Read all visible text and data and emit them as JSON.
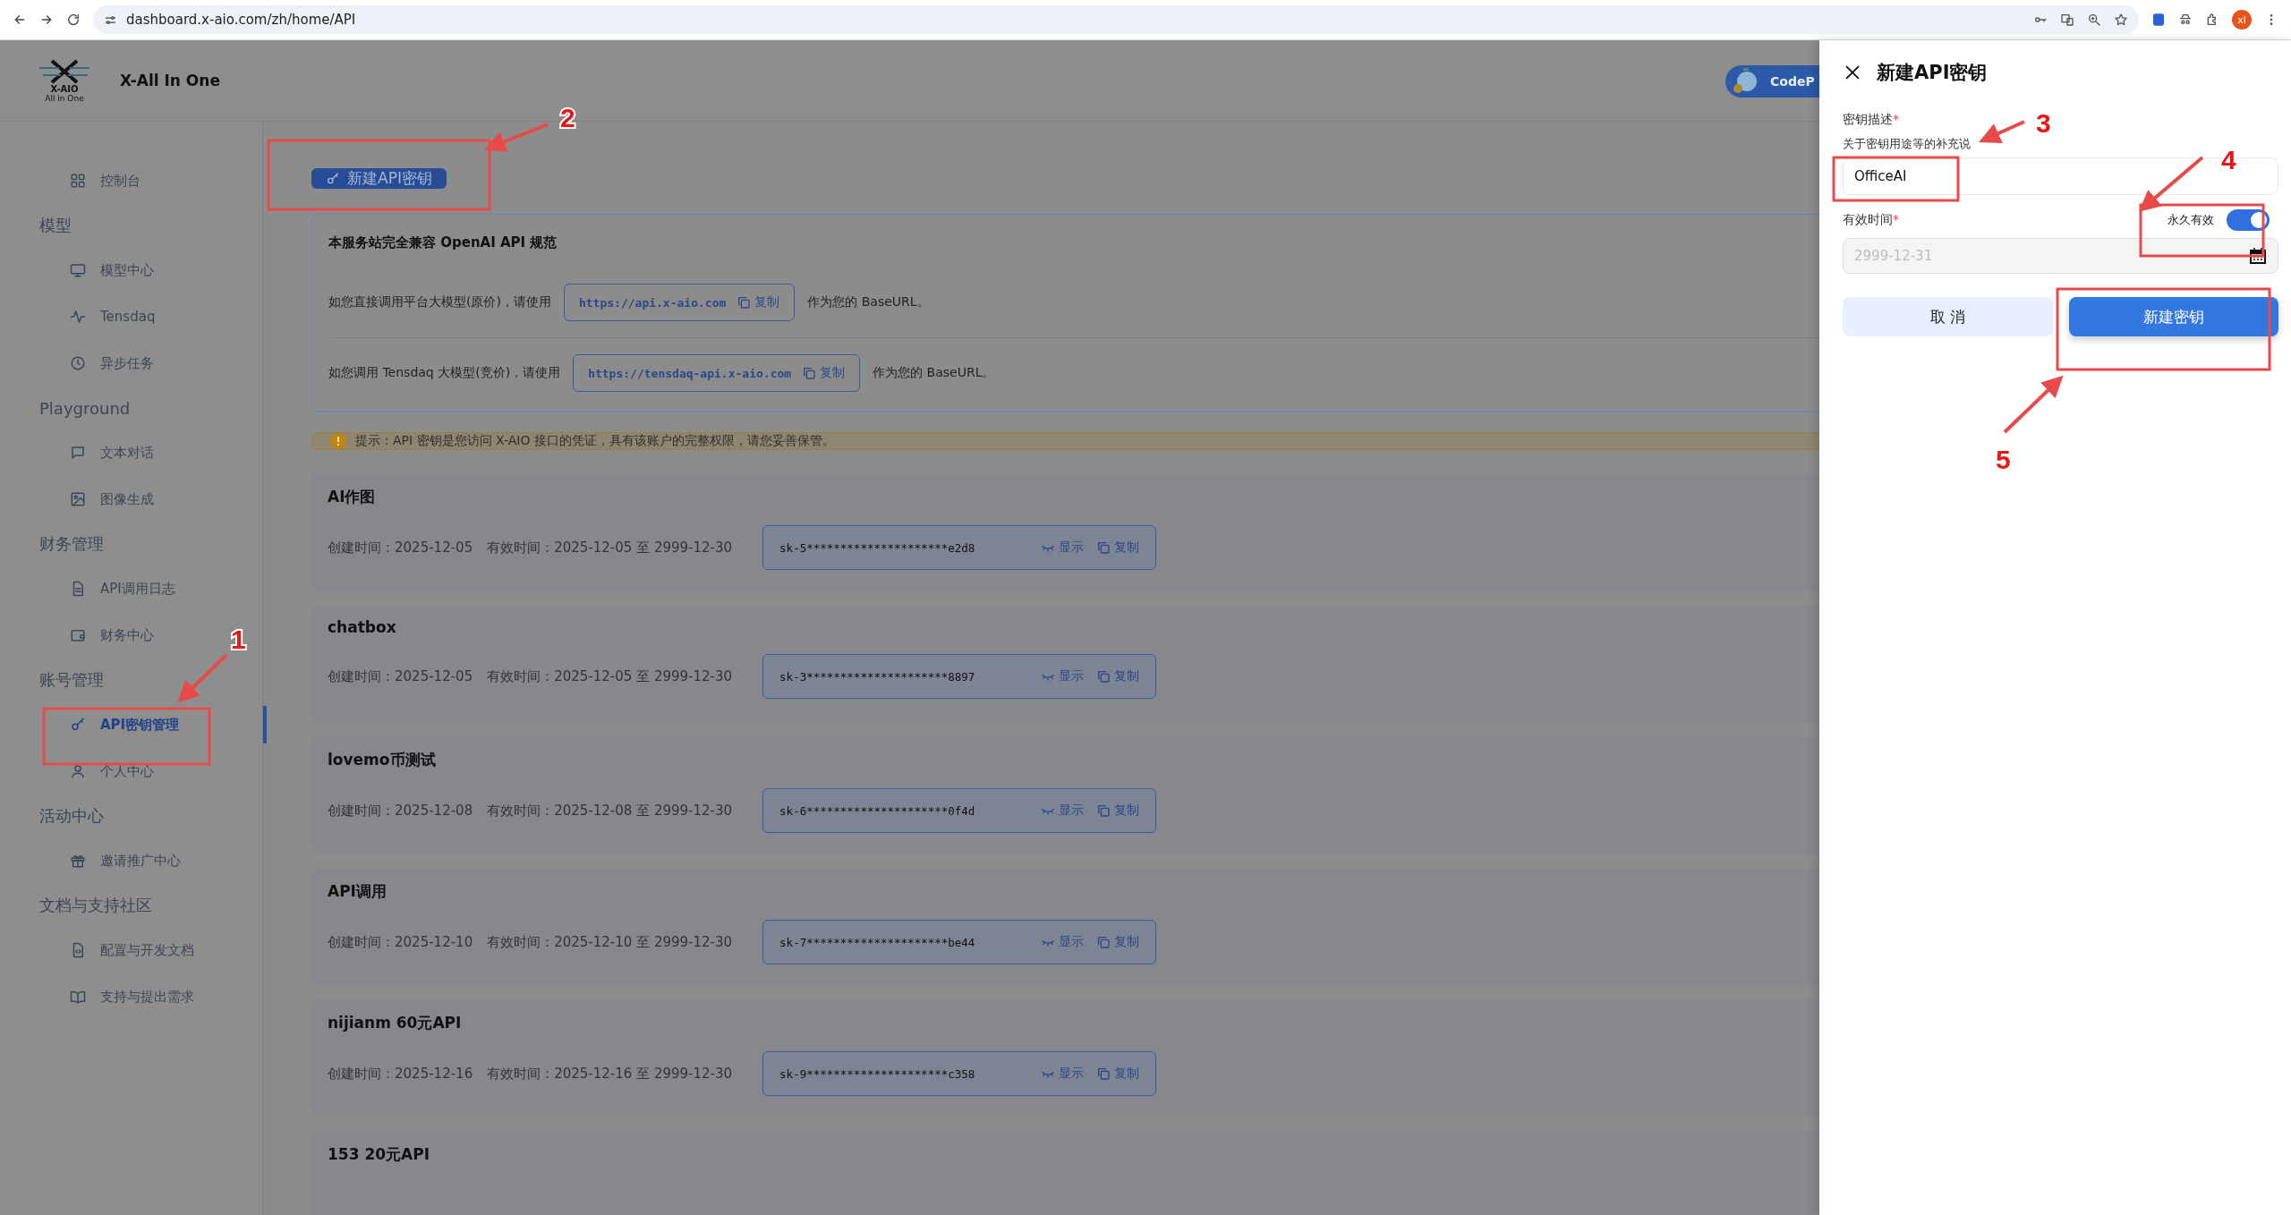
{
  "browser": {
    "url": "dashboard.x-aio.com/zh/home/API",
    "avatar": "xl"
  },
  "header": {
    "logo_text": "X-AIO",
    "logo_subtext": "All in One",
    "title": "X-All In One",
    "badge": "CodeP"
  },
  "sidebar": {
    "items": [
      {
        "kind": "item",
        "label": "控制台",
        "selected": false
      },
      {
        "kind": "section",
        "label": "模型"
      },
      {
        "kind": "item",
        "label": "模型中心",
        "selected": false
      },
      {
        "kind": "item",
        "label": "Tensdaq",
        "selected": false
      },
      {
        "kind": "item",
        "label": "异步任务",
        "selected": false
      },
      {
        "kind": "section",
        "label": "Playground"
      },
      {
        "kind": "item",
        "label": "文本对话",
        "selected": false
      },
      {
        "kind": "item",
        "label": "图像生成",
        "selected": false
      },
      {
        "kind": "section",
        "label": "财务管理"
      },
      {
        "kind": "item",
        "label": "API调用日志",
        "selected": false
      },
      {
        "kind": "item",
        "label": "财务中心",
        "selected": false
      },
      {
        "kind": "section",
        "label": "账号管理"
      },
      {
        "kind": "item",
        "label": "API密钥管理",
        "selected": true
      },
      {
        "kind": "item",
        "label": "个人中心",
        "selected": false
      },
      {
        "kind": "section",
        "label": "活动中心"
      },
      {
        "kind": "item",
        "label": "邀请推广中心",
        "selected": false
      },
      {
        "kind": "section",
        "label": "文档与支持社区"
      },
      {
        "kind": "item",
        "label": "配置与开发文档",
        "selected": false
      },
      {
        "kind": "item",
        "label": "支持与提出需求",
        "selected": false
      }
    ]
  },
  "new_key_button": "新建API密钥",
  "info": {
    "title": "本服务站完全兼容 OpenAI API 规范",
    "rows": [
      {
        "before": "如您直接调用平台大模型(原价)，请使用",
        "url": "https://api.x-aio.com",
        "copy": "复制",
        "after": "作为您的 BaseURL。"
      },
      {
        "before": "如您调用 Tensdaq 大模型(竞价)，请使用",
        "url": "https://tensdaq-api.x-aio.com",
        "copy": "复制",
        "after": "作为您的 BaseURL。"
      }
    ]
  },
  "notice": "提示：API 密钥是您访问 X-AIO 接口的凭证，具有该账户的完整权限，请您妥善保管。",
  "keys": [
    {
      "name": "AI作图",
      "created": "创建时间：2025-12-05",
      "validity": "有效时间：2025-12-05 至 2999-12-30",
      "key": "sk-5*********************e2d8",
      "show": "显示",
      "copy": "复制"
    },
    {
      "name": "chatbox",
      "created": "创建时间：2025-12-05",
      "validity": "有效时间：2025-12-05 至 2999-12-30",
      "key": "sk-3*********************8897",
      "show": "显示",
      "copy": "复制"
    },
    {
      "name": "lovemo币测试",
      "created": "创建时间：2025-12-08",
      "validity": "有效时间：2025-12-08 至 2999-12-30",
      "key": "sk-6*********************0f4d",
      "show": "显示",
      "copy": "复制"
    },
    {
      "name": "API调用",
      "created": "创建时间：2025-12-10",
      "validity": "有效时间：2025-12-10 至 2999-12-30",
      "key": "sk-7*********************be44",
      "show": "显示",
      "copy": "复制"
    },
    {
      "name": "nijianm 60元API",
      "created": "创建时间：2025-12-16",
      "validity": "有效时间：2025-12-16 至 2999-12-30",
      "key": "sk-9*********************c358",
      "show": "显示",
      "copy": "复制"
    },
    {
      "name": "153 20元API"
    }
  ],
  "drawer": {
    "title": "新建API密钥",
    "description": {
      "label": "密钥描述",
      "mark": "*",
      "hint": "关于密钥用途等的补充说",
      "value": "OfficeAI"
    },
    "validity": {
      "label": "有效时间",
      "mark": "*",
      "permanent_label": "永久有效",
      "permanent": true,
      "date": "2999-12-31",
      "disabled": true
    },
    "cancel": "取 消",
    "submit": "新建密钥"
  },
  "annotations": [
    {
      "number": "1"
    },
    {
      "number": "2"
    },
    {
      "number": "3"
    },
    {
      "number": "4"
    },
    {
      "number": "5"
    }
  ]
}
